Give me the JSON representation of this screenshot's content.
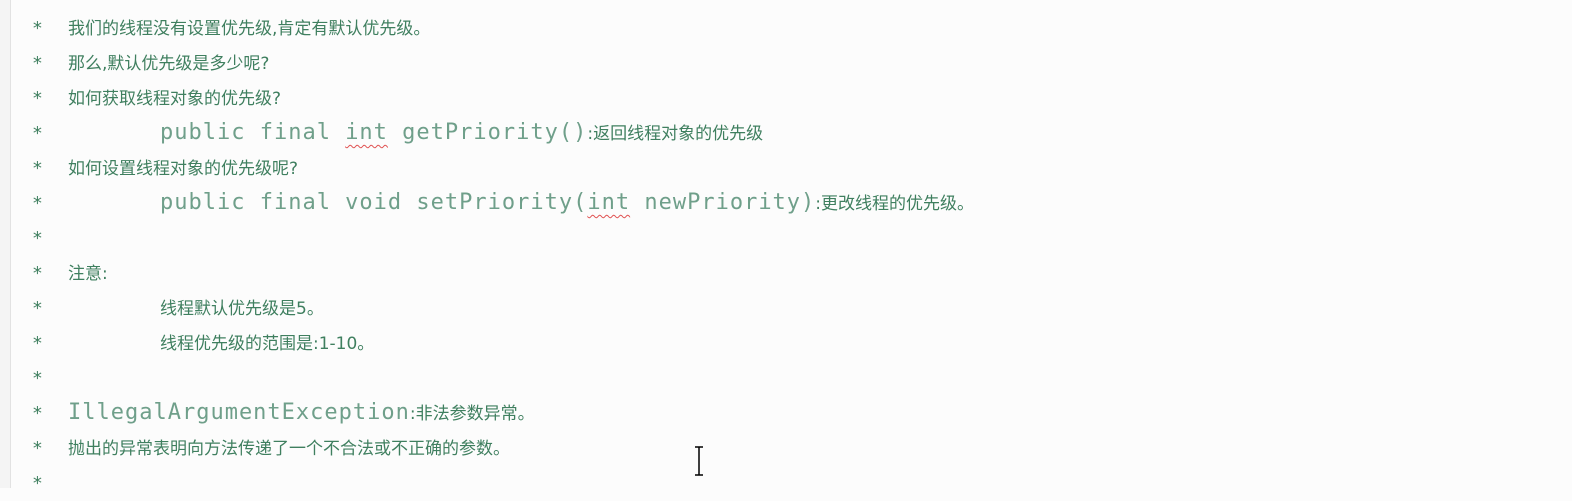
{
  "lines": [
    {
      "text": "我们的线程没有设置优先级,肯定有默认优先级。"
    },
    {
      "text": "那么,默认优先级是多少呢?"
    },
    {
      "text": "如何获取线程对象的优先级?"
    },
    {
      "code_a": "public final ",
      "code_sq": "int",
      "code_b": " getPriority()",
      "text": ":返回线程对象的优先级"
    },
    {
      "text": "如何设置线程对象的优先级呢?"
    },
    {
      "code_a": "public final void setPriority(",
      "code_sq": "int",
      "code_b": " newPriority)",
      "text": ":更改线程的优先级。"
    },
    {},
    {
      "text": "注意:"
    },
    {
      "text": "线程默认优先级是5。"
    },
    {
      "text": "线程优先级的范围是:1-10。"
    },
    {},
    {
      "code_a": "IllegalArgumentException",
      "text": ":非法参数异常。"
    },
    {
      "text": "抛出的异常表明向方法传递了一个不合法或不正确的参数。"
    },
    {}
  ],
  "star": "*"
}
